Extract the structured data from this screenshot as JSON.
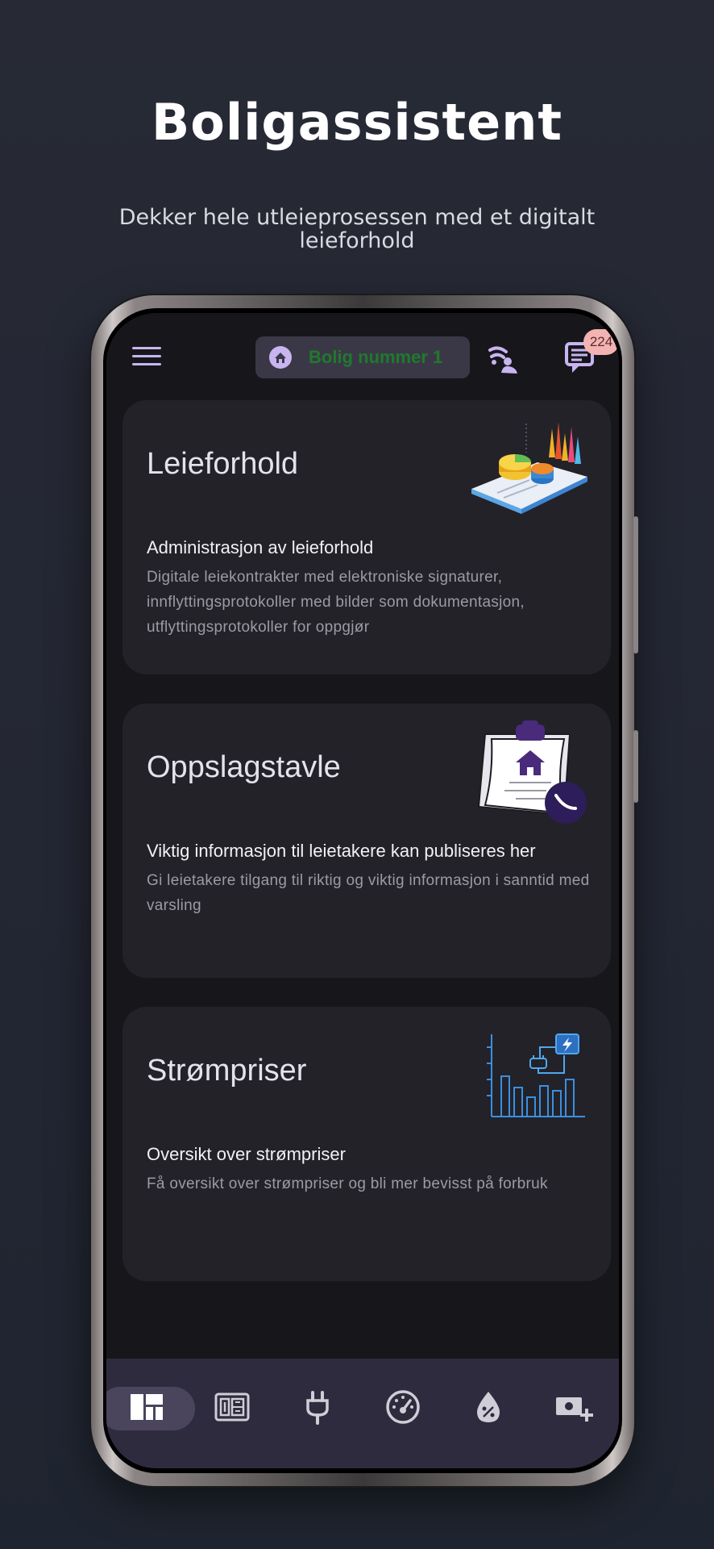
{
  "promo": {
    "title": "Boligassistent",
    "subtitle": "Dekker hele utleieprosessen med et digitalt leieforhold"
  },
  "topbar": {
    "menu_icon": "hamburger-menu-icon",
    "house_icon": "home-icon",
    "house_label": "Bolig nummer 1",
    "connect_icon": "wifi-signal-icon",
    "chat_icon": "chat-icon",
    "chat_badge": "224"
  },
  "cards": [
    {
      "title": "Leieforhold",
      "subtitle": "Administrasjon av leieforhold",
      "description": "Digitale leiekontrakter med elektroniske signaturer, innflyttingsprotokoller med bilder som dokumentasjon, utflyttingsprotokoller for oppgjør",
      "icon": "analytics-illustration"
    },
    {
      "title": "Oppslagstavle",
      "subtitle": "Viktig informasjon til leietakere kan publiseres her",
      "description": "Gi leietakere tilgang til riktig og viktig informasjon i sanntid med varsling",
      "icon": "clipboard-house-illustration"
    },
    {
      "title": "Strømpriser",
      "subtitle": "Oversikt over strømpriser",
      "description": "Få oversikt over strømpriser og bli mer bevisst på forbruk",
      "icon": "power-chart-illustration"
    }
  ],
  "bottom_nav": [
    {
      "icon": "dashboard-icon",
      "selected": true
    },
    {
      "icon": "meter-icon",
      "selected": false
    },
    {
      "icon": "plug-icon",
      "selected": false
    },
    {
      "icon": "gauge-icon",
      "selected": false
    },
    {
      "icon": "water-drop-icon",
      "selected": false
    },
    {
      "icon": "add-payment-icon",
      "selected": false
    }
  ],
  "colors": {
    "accent": "#c8b5f0",
    "house_label": "#1f7a2c",
    "card_bg": "#232229",
    "app_bg": "#17171b",
    "nav_bg": "#2f2b3f"
  }
}
